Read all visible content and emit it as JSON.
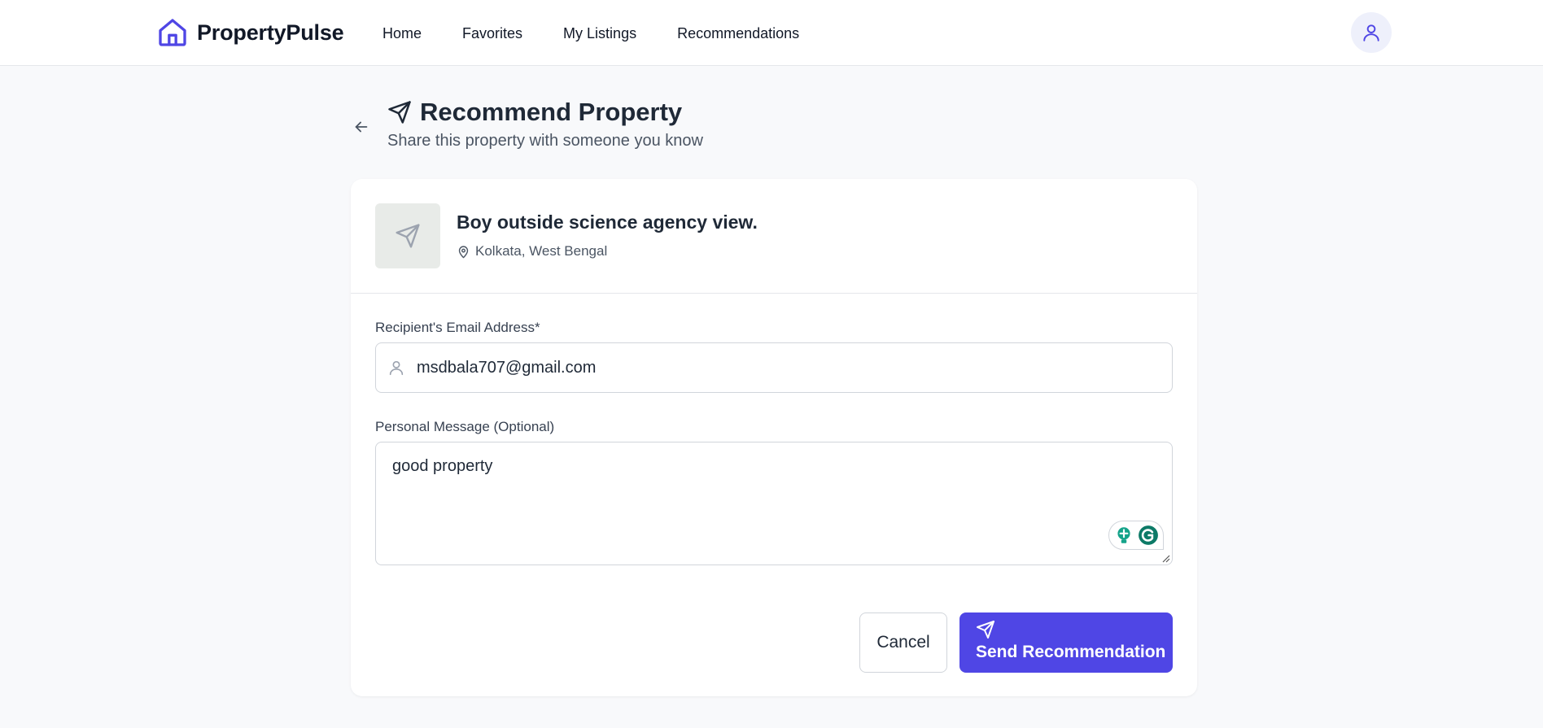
{
  "header": {
    "brand": "PropertyPulse",
    "nav": [
      {
        "label": "Home"
      },
      {
        "label": "Favorites"
      },
      {
        "label": "My Listings"
      },
      {
        "label": "Recommendations"
      }
    ],
    "brand_color": "#4f46e5"
  },
  "page": {
    "title": "Recommend Property",
    "subtitle": "Share this property with someone you know"
  },
  "property": {
    "title": "Boy outside science agency view.",
    "location": "Kolkata, West Bengal"
  },
  "form": {
    "email_label": "Recipient's Email Address*",
    "email_value": "msdbala707@gmail.com",
    "message_label": "Personal Message (Optional)",
    "message_value": "good property"
  },
  "actions": {
    "cancel_label": "Cancel",
    "send_label": "Send Recommendation",
    "primary_color": "#4f46e5"
  },
  "icons": [
    "house-logo-icon",
    "user-icon",
    "arrow-left-icon",
    "send-icon",
    "map-pin-icon",
    "grammarly-icon"
  ]
}
